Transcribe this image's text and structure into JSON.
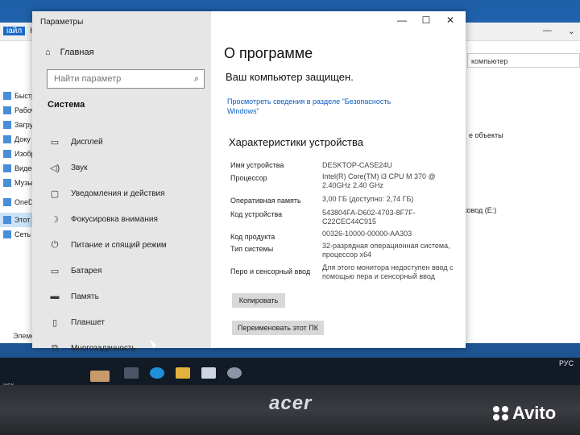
{
  "explorer": {
    "tabs": [
      "iaйл",
      "Ко"
    ],
    "address": "компьютер",
    "nav": [
      "Быстры",
      "Рабоч",
      "Загру",
      "Доку",
      "Изобр",
      "Видео",
      "Музы",
      "OneDriv",
      "Этот ко",
      "Сеть"
    ],
    "right_labels": [
      "е объекты",
      "исковод (E:)"
    ],
    "status": "Элементов: 1"
  },
  "settings": {
    "window_title": "Параметры",
    "controls": [
      "—",
      "☐",
      "✕"
    ],
    "home_label": "Главная",
    "search_placeholder": "Найти параметр",
    "section_label": "Система",
    "menu": [
      {
        "icon": "monitor-icon",
        "label": "Дисплей"
      },
      {
        "icon": "speaker-icon",
        "label": "Звук"
      },
      {
        "icon": "notifications-icon",
        "label": "Уведомления и действия"
      },
      {
        "icon": "moon-icon",
        "label": "Фокусировка внимания"
      },
      {
        "icon": "power-icon",
        "label": "Питание и спящий режим"
      },
      {
        "icon": "battery-icon",
        "label": "Батарея"
      },
      {
        "icon": "storage-icon",
        "label": "Память"
      },
      {
        "icon": "tablet-icon",
        "label": "Планшет"
      },
      {
        "icon": "multitasking-icon",
        "label": "Многозадачность"
      }
    ],
    "page_title": "О программе",
    "protected_text": "Ваш компьютер защищен.",
    "security_link": "Просмотреть сведения в разделе \"Безопасность Windows\"",
    "device_specs_title": "Характеристики устройства",
    "specs": [
      {
        "label": "Имя устройства",
        "value": "DESKTOP-CASE24U"
      },
      {
        "label": "Процессор",
        "value": "Intel(R) Core(TM) i3 CPU       M 370  @ 2.40GHz   2.40 GHz"
      },
      {
        "label": "Оперативная память",
        "value": "3,00 ГБ (доступно: 2,74 ГБ)"
      },
      {
        "label": "Код устройства",
        "value": "543804FA-D602-4703-8F7F-C22CEC44C915"
      },
      {
        "label": "Код продукта",
        "value": "00326-10000-00000-AA303"
      },
      {
        "label": "Тип системы",
        "value": "32-разрядная операционная система, процессор x64"
      },
      {
        "label": "Перо и сенсорный ввод",
        "value": "Для этого монитора недоступен ввод с помощью пера и сенсорный ввод"
      }
    ],
    "copy_button": "Копировать",
    "rename_button": "Переименовать этот ПК"
  },
  "taskbar": {
    "search_text": "иск",
    "language": "РУС",
    "colors": {
      "accent": "#0a5cbf",
      "taskbar": "#121a26"
    }
  },
  "laptop": {
    "brand": "acer",
    "watermark": "Avito"
  }
}
